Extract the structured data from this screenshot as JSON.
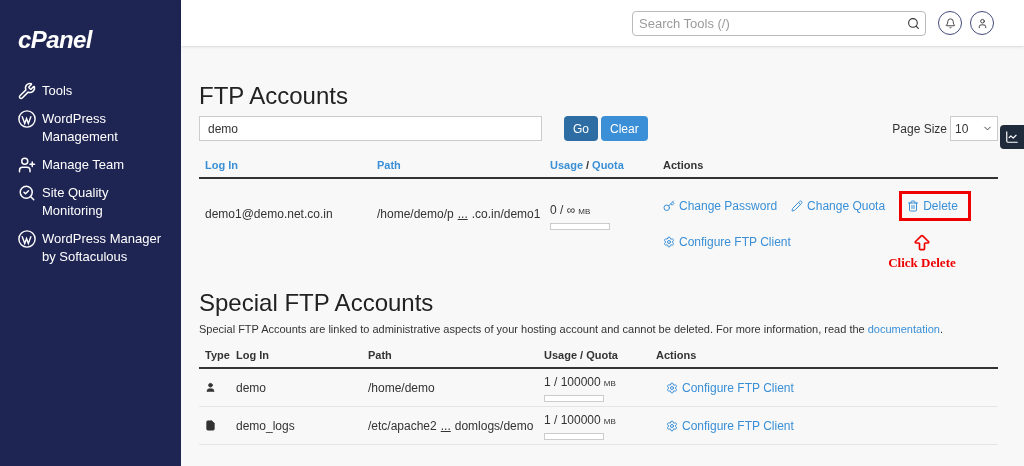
{
  "sidebar": {
    "logo": "cPanel",
    "items": [
      {
        "kind": "tools",
        "label": "Tools"
      },
      {
        "kind": "wordpress",
        "label": "WordPress Management"
      },
      {
        "kind": "team",
        "label": "Manage Team"
      },
      {
        "kind": "quality",
        "label": "Site Quality Monitoring"
      },
      {
        "kind": "wordpress",
        "label": "WordPress Manager by Softaculous"
      }
    ]
  },
  "header": {
    "search": {
      "placeholder": "Search Tools (/)"
    }
  },
  "ftp": {
    "title": "FTP Accounts",
    "filter": {
      "value": "demo"
    },
    "buttons": [
      {
        "label": "Go",
        "kind": "dark"
      },
      {
        "label": "Clear",
        "kind": "light"
      }
    ],
    "page_size": {
      "label": "Page Size",
      "value": "10"
    },
    "columns": [
      {
        "label": "Log In"
      },
      {
        "label": "Path"
      },
      {
        "usage": "Usage",
        "sep": "/",
        "quota": "Quota"
      },
      {
        "label": "Actions"
      }
    ],
    "rows": [
      {
        "login": "demo1@demo.net.co.in",
        "path_start": "/home/demo/p",
        "ellipsis": "...",
        "path_end": ".co.in/demo1",
        "usage": "0 / ∞",
        "unit": "MB",
        "actions": [
          {
            "kind": "key",
            "label": "Change Password",
            "highlighted": false
          },
          {
            "kind": "pencil",
            "label": "Change Quota",
            "highlighted": false
          },
          {
            "kind": "trash",
            "label": "Delete",
            "highlighted": true
          },
          {
            "kind": "gear",
            "label": "Configure FTP Client",
            "highlighted": false
          }
        ]
      }
    ],
    "annotation": "Click Delete"
  },
  "special": {
    "title": "Special FTP Accounts",
    "description": "Special FTP Accounts are linked to administrative aspects of your hosting account and cannot be deleted. For more information, read the",
    "link": "documentation",
    "end": ".",
    "columns": [
      "Type",
      "Log In",
      "Path",
      "Usage / Quota",
      "Actions"
    ],
    "rows": [
      {
        "kind": "user",
        "login": "demo",
        "path_start": "/home/demo",
        "usage": "1 / 100000",
        "unit": "MB",
        "action": "Configure FTP Client"
      },
      {
        "kind": "file",
        "login": "demo_logs",
        "path_start": "/etc/apache2",
        "ellipsis": "...",
        "path_end": "domlogs/demo",
        "usage": "1 / 100000",
        "unit": "MB",
        "action": "Configure FTP Client"
      }
    ]
  }
}
